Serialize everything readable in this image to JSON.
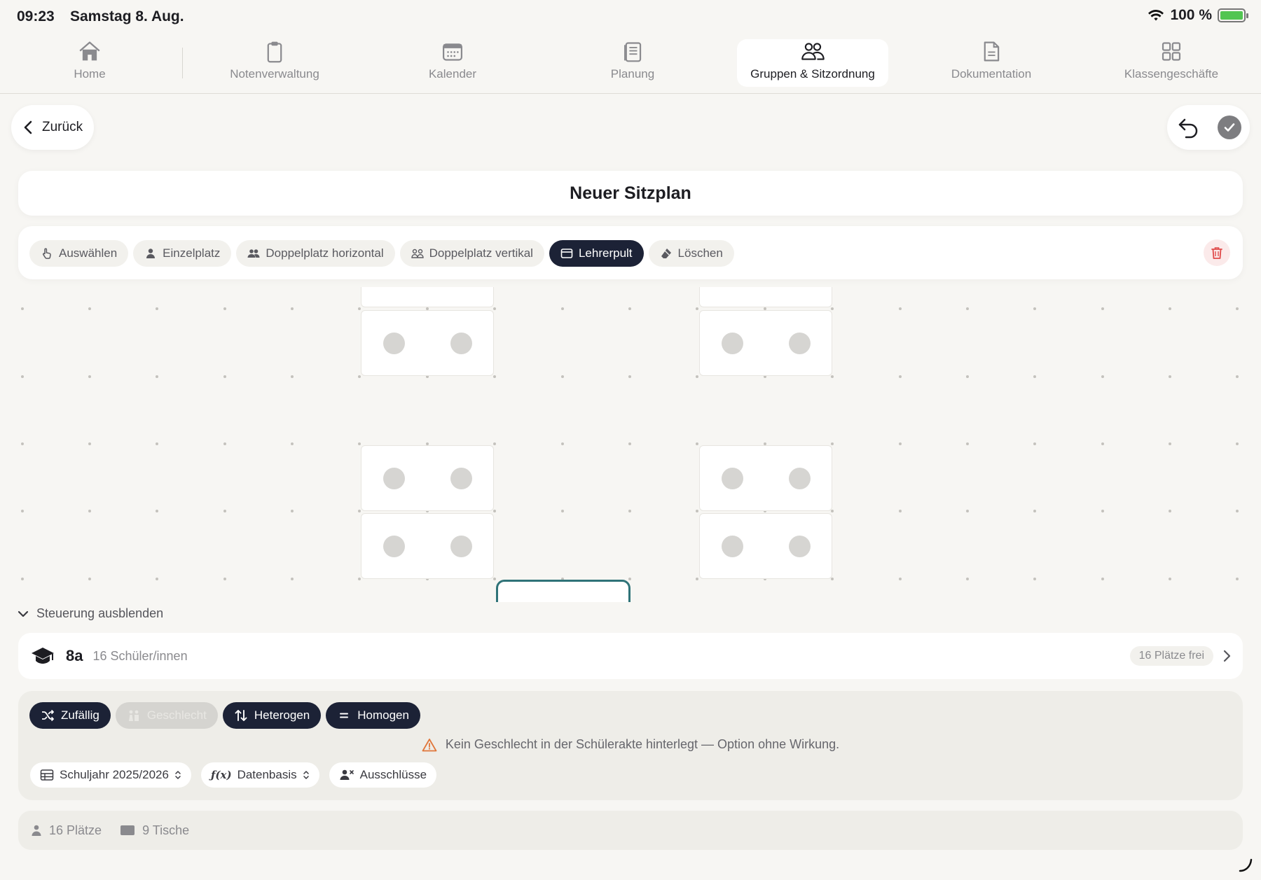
{
  "status": {
    "time": "09:23",
    "date": "Samstag 8. Aug.",
    "battery": "100 %",
    "battery_level": 1.0
  },
  "tabs": [
    {
      "label": "Home",
      "icon": "house-icon",
      "active": false
    },
    {
      "label": "Notenverwaltung",
      "icon": "clipboard-icon",
      "active": false
    },
    {
      "label": "Kalender",
      "icon": "calendar-icon",
      "active": false
    },
    {
      "label": "Planung",
      "icon": "notebook-icon",
      "active": false
    },
    {
      "label": "Gruppen & Sitzordnung",
      "icon": "people-icon",
      "active": true
    },
    {
      "label": "Dokumentation",
      "icon": "document-icon",
      "active": false
    },
    {
      "label": "Klassengeschäfte",
      "icon": "grid-icon",
      "active": false
    }
  ],
  "nav": {
    "back_label": "Zurück"
  },
  "title": "Neuer Sitzplan",
  "tools": [
    {
      "label": "Auswählen",
      "icon": "hand-pointer-icon",
      "active": false
    },
    {
      "label": "Einzelplatz",
      "icon": "person-icon",
      "active": false
    },
    {
      "label": "Doppelplatz horizontal",
      "icon": "two-people-icon",
      "active": false
    },
    {
      "label": "Doppelplatz vertikal",
      "icon": "two-people-outline-icon",
      "active": false
    },
    {
      "label": "Lehrerpult",
      "icon": "desk-icon",
      "active": true
    },
    {
      "label": "Löschen",
      "icon": "eraser-icon",
      "active": false
    }
  ],
  "controls": {
    "toggle_label": "Steuerung ausblenden"
  },
  "class_info": {
    "name": "8a",
    "students": "16 Schüler/innen",
    "free": "16 Plätze frei"
  },
  "strategies": [
    {
      "label": "Zufällig",
      "icon": "shuffle-icon",
      "enabled": true
    },
    {
      "label": "Geschlecht",
      "icon": "gender-icon",
      "enabled": false
    },
    {
      "label": "Heterogen",
      "icon": "arrows-updown-icon",
      "enabled": true
    },
    {
      "label": "Homogen",
      "icon": "equals-icon",
      "enabled": true
    }
  ],
  "warning": "Kein Geschlecht in der Schülerakte hinterlegt — Option ohne Wirkung.",
  "selectors": [
    {
      "label": "Schuljahr 2025/2026",
      "icon": "table-icon"
    },
    {
      "label": "Datenbasis",
      "icon": "function-icon"
    },
    {
      "label": "Ausschlüsse",
      "icon": "person-x-icon"
    }
  ],
  "stats": {
    "seats": "16 Plätze",
    "tables": "9 Tische"
  },
  "colors": {
    "accent_dark": "#1c2236",
    "teacher_desk": "#2f7378",
    "warning": "#e0763a",
    "danger": "#e04a4a",
    "battery": "#52c552"
  }
}
